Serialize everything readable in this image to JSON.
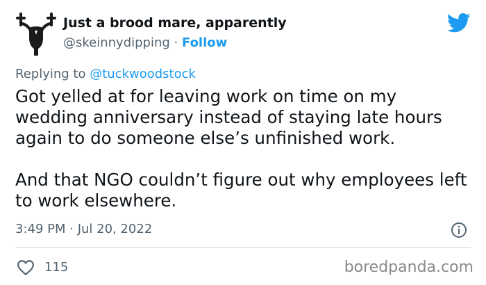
{
  "tweet": {
    "author_name": "Just a brood mare, apparently",
    "author_handle": "@skeinnydipping",
    "separator": " · ",
    "follow_label": "Follow",
    "replying_prefix": "Replying to ",
    "replying_to": "@tuckwoodstock",
    "paragraph_1": "Got yelled at for leaving work on time on my wedding anniversary instead of staying late hours again to do someone else’s unfinished work.",
    "paragraph_2": "And that NGO couldn’t figure out why employees left to work elsewhere.",
    "timestamp": "3:49 PM · Jul 20, 2022",
    "like_count": "115"
  },
  "watermark": "boredpanda.com",
  "icons": {
    "avatar": "uterus-avatar-icon",
    "brand": "twitter-bird-icon",
    "info": "info-icon",
    "like": "heart-icon"
  },
  "colors": {
    "link": "#1d9bf0",
    "text": "#0f1419",
    "secondary": "#536471",
    "divider": "#cfd9de"
  }
}
